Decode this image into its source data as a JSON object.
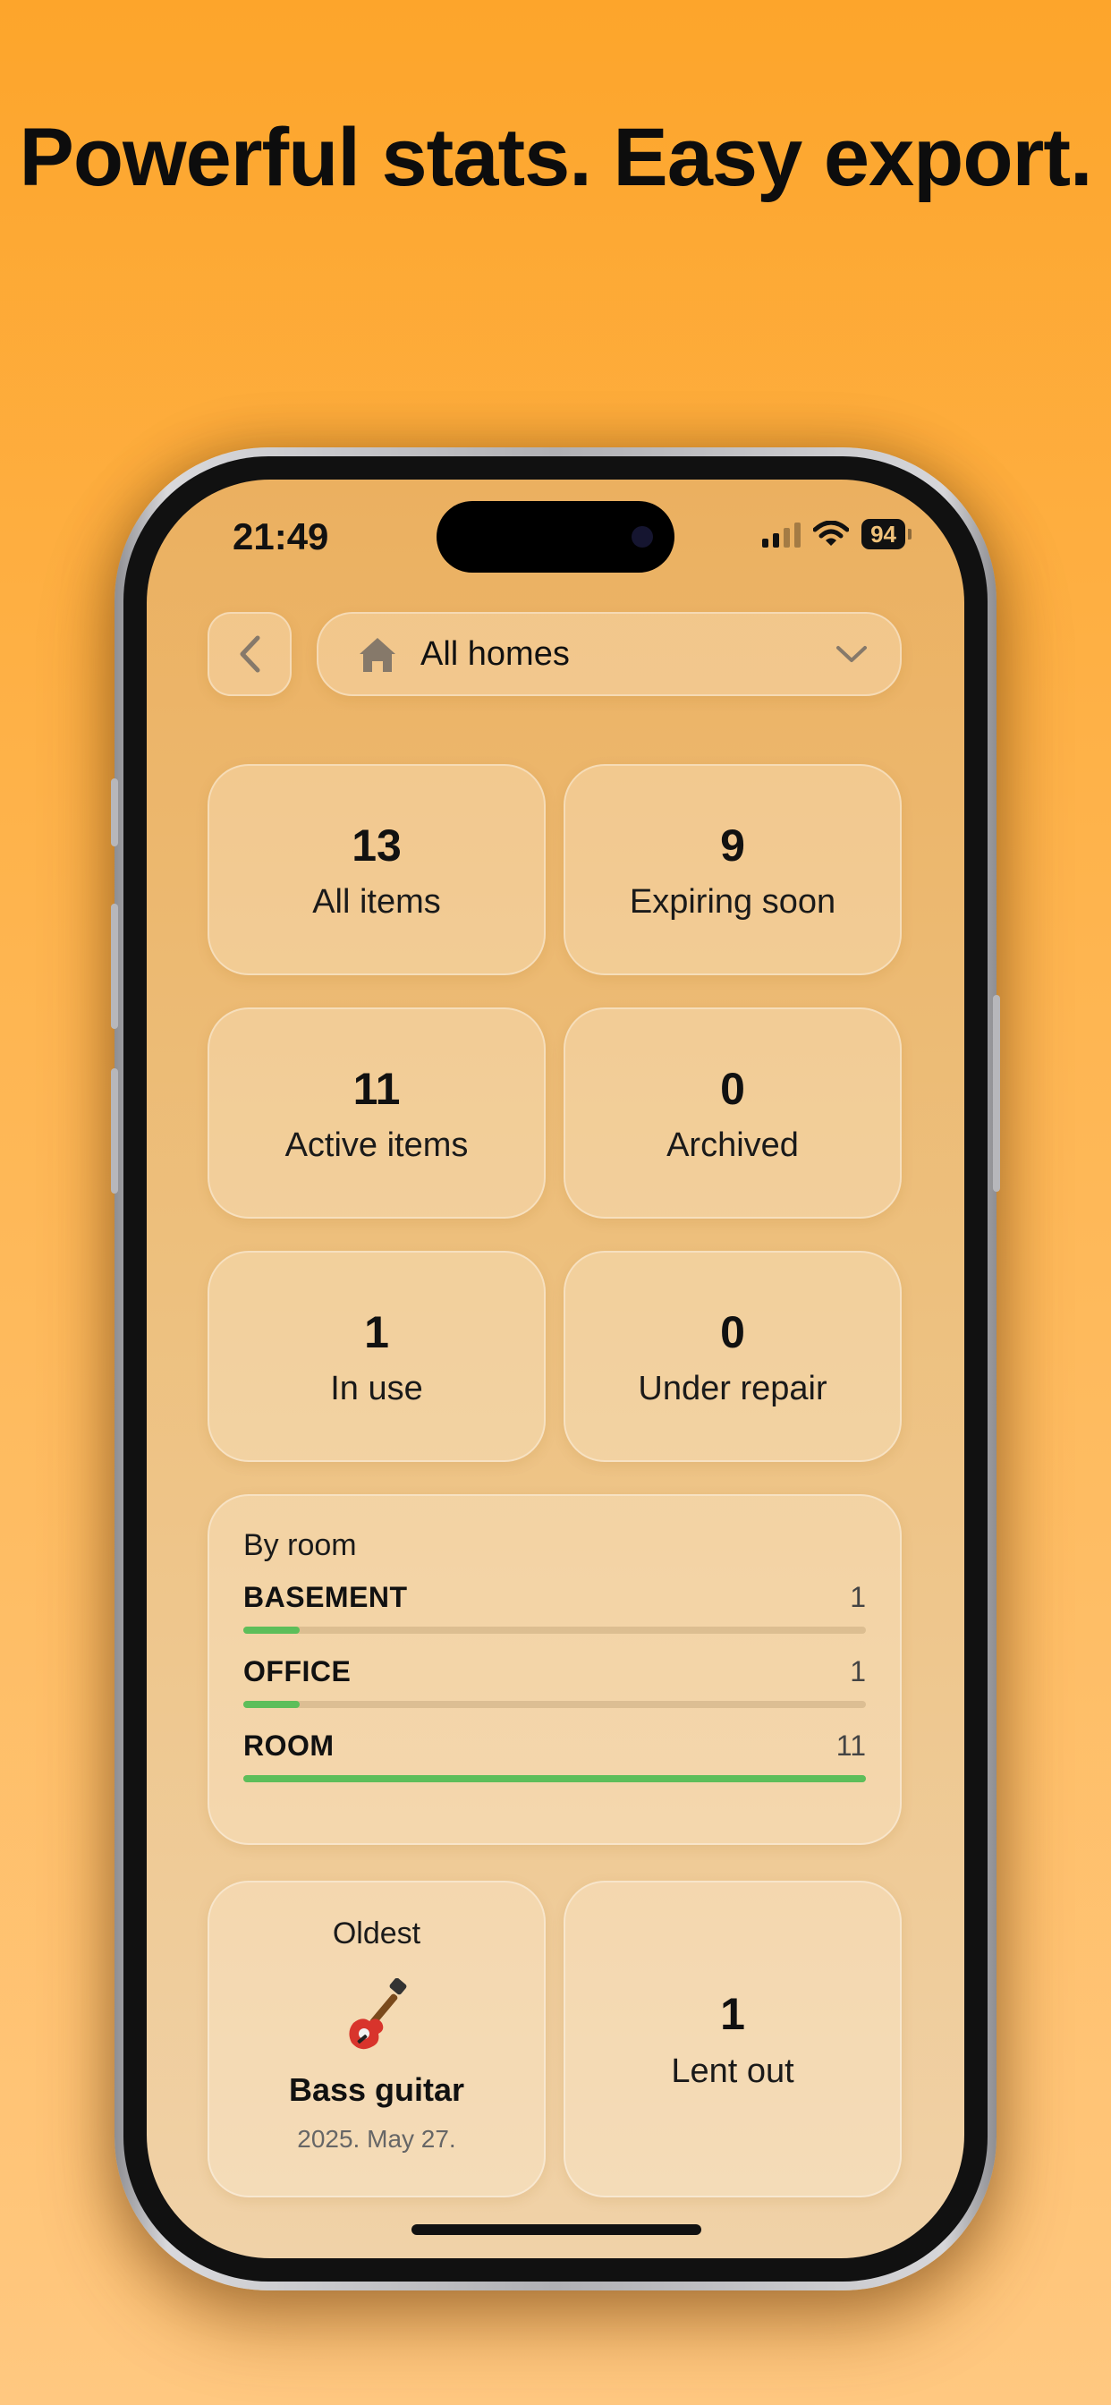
{
  "headline": "Powerful stats. Easy export.",
  "status_bar": {
    "time": "21:49",
    "battery": "94"
  },
  "header": {
    "back_icon": "chevron-left-icon",
    "home_selector": {
      "label": "All homes",
      "icon": "house-icon",
      "dropdown_icon": "chevron-down-icon"
    }
  },
  "stats": [
    {
      "value": "13",
      "label": "All items"
    },
    {
      "value": "9",
      "label": "Expiring soon"
    },
    {
      "value": "11",
      "label": "Active items"
    },
    {
      "value": "0",
      "label": "Archived"
    },
    {
      "value": "1",
      "label": "In use"
    },
    {
      "value": "0",
      "label": "Under repair"
    }
  ],
  "by_room": {
    "title": "By room",
    "rooms": [
      {
        "name": "BASEMENT",
        "count": "1",
        "fraction": 0.09
      },
      {
        "name": "OFFICE",
        "count": "1",
        "fraction": 0.09
      },
      {
        "name": "ROOM",
        "count": "11",
        "fraction": 1.0
      }
    ],
    "bar_color": "#5DBE5A"
  },
  "oldest": {
    "title": "Oldest",
    "icon": "guitar-icon",
    "item": "Bass guitar",
    "date": "2025. May 27."
  },
  "lent_out": {
    "value": "1",
    "label": "Lent out"
  }
}
